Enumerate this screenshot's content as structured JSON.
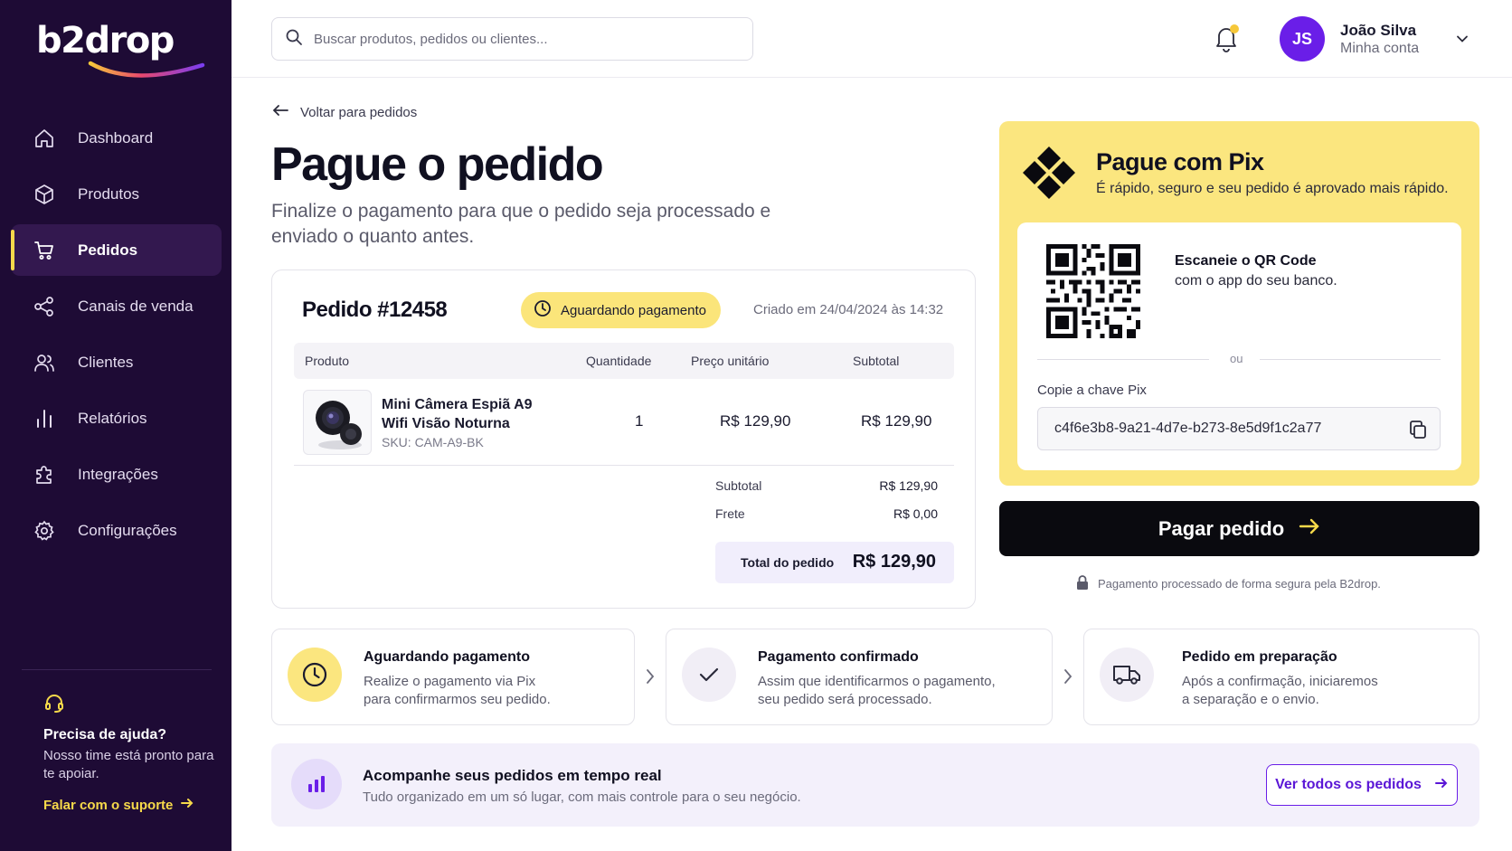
{
  "brand": {
    "name": "b2drop",
    "accent": "#6a1ee8",
    "yellow": "#fbe67f",
    "sidebar_bg": "#1e0b35"
  },
  "sidebar": {
    "items": [
      {
        "label": "Dashboard",
        "icon": "home-icon",
        "active": false
      },
      {
        "label": "Produtos",
        "icon": "box-icon",
        "active": false
      },
      {
        "label": "Pedidos",
        "icon": "cart-icon",
        "active": true
      },
      {
        "label": "Canais de venda",
        "icon": "share-icon",
        "active": false
      },
      {
        "label": "Clientes",
        "icon": "users-icon",
        "active": false
      },
      {
        "label": "Relatórios",
        "icon": "bar-chart-icon",
        "active": false
      },
      {
        "label": "Integrações",
        "icon": "puzzle-icon",
        "active": false
      },
      {
        "label": "Configurações",
        "icon": "gear-icon",
        "active": false
      }
    ],
    "help": {
      "title": "Precisa de ajuda?",
      "text": "Nosso time está pronto para te apoiar.",
      "link": "Falar com o suporte"
    }
  },
  "header": {
    "search_placeholder": "Buscar produtos, pedidos ou clientes...",
    "user": {
      "initials": "JS",
      "name": "João Silva",
      "sub": "Minha conta"
    }
  },
  "page": {
    "back_label": "Voltar para pedidos",
    "title": "Pague o pedido",
    "subtitle": "Finalize o pagamento para que o pedido seja processado e enviado o quanto antes."
  },
  "order": {
    "title": "Pedido #12458",
    "status": "Aguardando pagamento",
    "created": "Criado em 24/04/2024 às 14:32",
    "columns": {
      "product": "Produto",
      "qty": "Quantidade",
      "unit": "Preço unitário",
      "subtotal": "Subtotal"
    },
    "item": {
      "name": "Mini Câmera Espiã A9 Wifi Visão Noturna",
      "sku": "SKU: CAM-A9-BK",
      "qty": "1",
      "unit_price": "R$ 129,90",
      "subtotal": "R$ 129,90"
    },
    "totals": {
      "subtotal_label": "Subtotal",
      "subtotal": "R$ 129,90",
      "shipping_label": "Frete",
      "shipping": "R$ 0,00",
      "total_label": "Total do pedido",
      "total": "R$ 129,90"
    }
  },
  "pix": {
    "title": "Pague com Pix",
    "subtitle": "É rápido, seguro e seu pedido é aprovado mais rápido.",
    "qr_title": "Escaneie o QR Code",
    "qr_sub": "com o app do seu banco.",
    "or": "ou",
    "copy_label": "Copie a chave Pix",
    "key": "c4f6e3b8-9a21-4d7e-b273-8e5d9f1c2a77"
  },
  "pay": {
    "button": "Pagar pedido",
    "secure_note": "Pagamento processado de forma segura pela B2drop."
  },
  "steps": [
    {
      "title": "Aguardando pagamento",
      "desc1": "Realize o pagamento via Pix",
      "desc2": "para confirmarmos seu pedido.",
      "icon": "clock-icon"
    },
    {
      "title": "Pagamento confirmado",
      "desc1": "Assim que identificarmos o pagamento,",
      "desc2": "seu pedido será processado.",
      "icon": "check-icon"
    },
    {
      "title": "Pedido em preparação",
      "desc1": "Após a confirmação, iniciaremos",
      "desc2": "a separação e o envio.",
      "icon": "truck-icon"
    }
  ],
  "banner": {
    "title": "Acompanhe seus pedidos em tempo real",
    "text": "Tudo organizado em um só lugar, com mais controle para o seu negócio.",
    "button": "Ver todos os pedidos"
  }
}
